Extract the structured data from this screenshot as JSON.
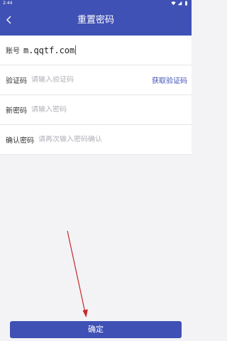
{
  "status_bar": {
    "time": "2:44",
    "icons": [
      "wifi-icon",
      "signal-icon",
      "battery-icon"
    ]
  },
  "app_bar": {
    "title": "重置密码",
    "back_icon": "chevron-left-icon"
  },
  "form": {
    "account": {
      "label": "账号",
      "value": "m.qqtf.com"
    },
    "verification_code": {
      "label": "验证码",
      "placeholder": "请输入验证码",
      "action_label": "获取验证码"
    },
    "new_password": {
      "label": "新密码",
      "placeholder": "请输入密码"
    },
    "confirm_password": {
      "label": "确认密码",
      "placeholder": "请再次输入密码确认"
    }
  },
  "confirm_button": {
    "label": "确定"
  },
  "colors": {
    "primary": "#3f51b5",
    "annotation_arrow": "#c62828",
    "background": "#f3f3f6"
  }
}
